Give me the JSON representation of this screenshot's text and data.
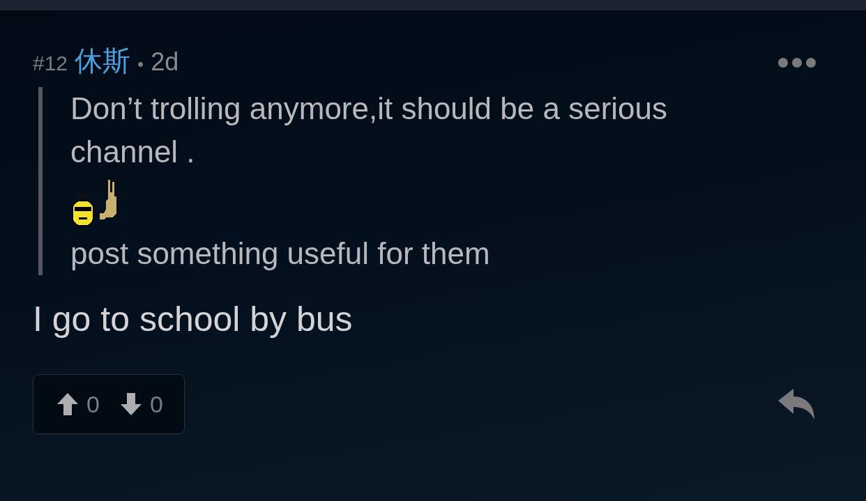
{
  "post": {
    "number": "#12",
    "author": "休斯",
    "separator": "•",
    "age": "2d"
  },
  "quote": [
    {
      "kind": "text",
      "text": "Don’t trolling anymore,it should be a serious channel ."
    },
    {
      "kind": "emoji"
    },
    {
      "kind": "text",
      "text": "post something useful for them"
    }
  ],
  "body": "I go to school by bus",
  "votes": {
    "up": "0",
    "down": "0"
  }
}
